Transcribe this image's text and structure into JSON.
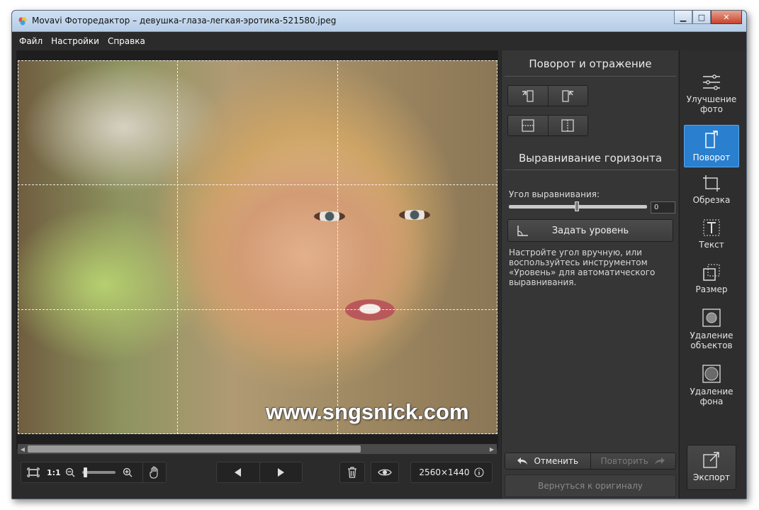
{
  "window": {
    "title": "Movavi Фоторедактор – девушка-глаза-легкая-эротика-521580.jpeg",
    "controls": {
      "minimize": "▁",
      "maximize": "□",
      "close": "✕"
    }
  },
  "menu": {
    "items": [
      "Файл",
      "Настройки",
      "Справка"
    ]
  },
  "canvas": {
    "watermark": "www.sngsnick.com",
    "grid": "rule-of-thirds"
  },
  "bottom_toolbar": {
    "zoom_ratio": "1:1",
    "image_size": "2560×1440",
    "icons": [
      "fit-screen-icon",
      "zoom-out-icon",
      "zoom-in-icon",
      "hand-icon",
      "prev-icon",
      "next-icon",
      "trash-icon",
      "eye-icon",
      "info-icon"
    ]
  },
  "right_panel": {
    "rotate_title": "Поворот и отражение",
    "horizon_title": "Выравнивание горизонта",
    "angle_label": "Угол выравнивания:",
    "angle_value": "0",
    "level_button": "Задать уровень",
    "help_text": "Настройте угол вручную, или воспользуйтесь инструментом «Уровень» для автоматического выравнивания.",
    "undo": "Отменить",
    "redo": "Повторить",
    "revert": "Вернуться к оригиналу"
  },
  "tools": {
    "enhance": "Улучшение фото",
    "rotate": "Поворот",
    "crop": "Обрезка",
    "text": "Текст",
    "resize": "Размер",
    "object_removal": "Удаление объектов",
    "bg_removal": "Удаление фона",
    "export": "Экспорт",
    "active": "rotate"
  },
  "colors": {
    "accent": "#2a7fcf",
    "panel": "#363636",
    "background": "#2b2b2b"
  }
}
